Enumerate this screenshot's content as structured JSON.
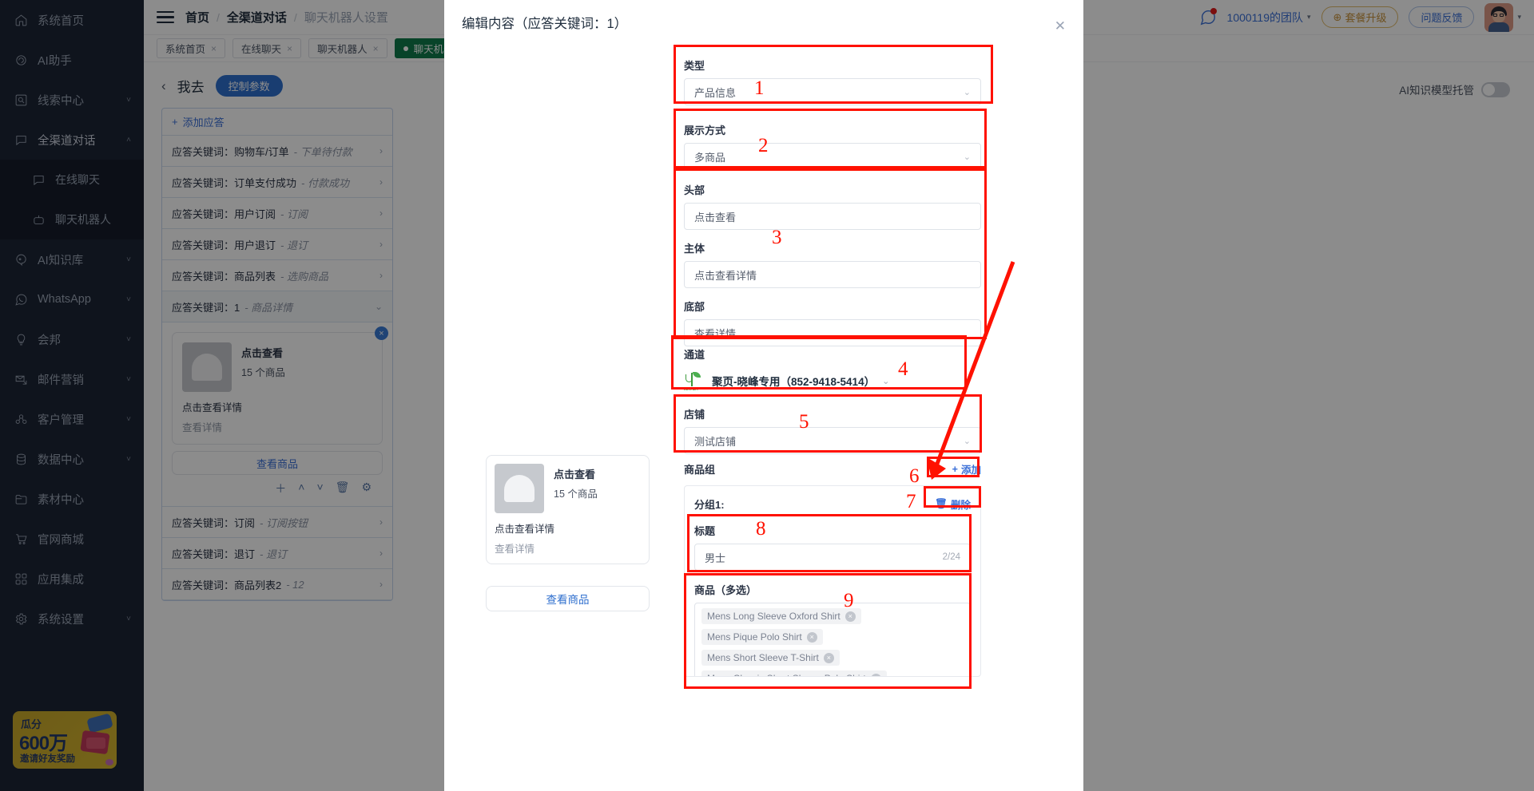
{
  "sidebar": {
    "items": [
      {
        "label": "系统首页",
        "icon": "home-icon",
        "chevron": false,
        "active": false
      },
      {
        "label": "AI助手",
        "icon": "ai-assistant-icon",
        "chevron": false,
        "active": false
      },
      {
        "label": "线索中心",
        "icon": "lead-center-icon",
        "chevron": true,
        "active": false
      },
      {
        "label": "全渠道对话",
        "icon": "omnichannel-icon",
        "chevron": true,
        "active": true,
        "expanded": true
      },
      {
        "label": "AI知识库",
        "icon": "knowledge-base-icon",
        "chevron": true,
        "active": false
      },
      {
        "label": "WhatsApp",
        "icon": "whatsapp-icon",
        "chevron": true,
        "active": false
      },
      {
        "label": "会邦",
        "icon": "huibang-icon",
        "chevron": true,
        "active": false
      },
      {
        "label": "邮件营销",
        "icon": "email-marketing-icon",
        "chevron": true,
        "active": false
      },
      {
        "label": "客户管理",
        "icon": "customer-management-icon",
        "chevron": true,
        "active": false
      },
      {
        "label": "数据中心",
        "icon": "data-center-icon",
        "chevron": true,
        "active": false
      },
      {
        "label": "素材中心",
        "icon": "material-center-icon",
        "chevron": false,
        "active": false
      },
      {
        "label": "官网商城",
        "icon": "shop-icon",
        "chevron": false,
        "active": false
      },
      {
        "label": "应用集成",
        "icon": "app-integration-icon",
        "chevron": false,
        "active": false
      },
      {
        "label": "系统设置",
        "icon": "settings-icon",
        "chevron": true,
        "active": false
      }
    ],
    "sub_items": [
      {
        "label": "在线聊天",
        "icon": "live-chat-icon"
      },
      {
        "label": "聊天机器人",
        "icon": "chatbot-icon"
      }
    ],
    "promo": {
      "line1": "瓜分",
      "line2": "600万",
      "line3": "邀请好友奖励"
    }
  },
  "topbar": {
    "breadcrumb": [
      "首页",
      "全渠道对话",
      "聊天机器人设置"
    ],
    "separator": "/",
    "team": "1000119的团队",
    "upgrade": "套餐升级",
    "feedback": "问题反馈"
  },
  "tabs": [
    {
      "label": "系统首页",
      "active": false
    },
    {
      "label": "在线聊天",
      "active": false
    },
    {
      "label": "聊天机器人",
      "active": false
    },
    {
      "label": "聊天机器人",
      "active": true
    }
  ],
  "panel": {
    "title": "我去",
    "control_button": "控制参数",
    "ai_toggle_label": "AI知识模型托管",
    "add_reply": "添加应答",
    "rows": [
      {
        "prefix": "应答关键词：",
        "keyword": "购物车/订单",
        "sub": "- 下单待付款",
        "expanded": false
      },
      {
        "prefix": "应答关键词：",
        "keyword": "订单支付成功",
        "sub": "- 付款成功",
        "expanded": false
      },
      {
        "prefix": "应答关键词：",
        "keyword": "用户订阅",
        "sub": "- 订阅",
        "expanded": false
      },
      {
        "prefix": "应答关键词：",
        "keyword": "用户退订",
        "sub": "- 退订",
        "expanded": false
      },
      {
        "prefix": "应答关键词：",
        "keyword": "商品列表",
        "sub": "- 选购商品",
        "expanded": false
      },
      {
        "prefix": "应答关键词：",
        "keyword": "1",
        "sub": "- 商品详情",
        "expanded": true
      }
    ],
    "rows_after": [
      {
        "prefix": "应答关键词：",
        "keyword": "订阅",
        "sub": "- 订阅按钮"
      },
      {
        "prefix": "应答关键词：",
        "keyword": "退订",
        "sub": "- 退订"
      },
      {
        "prefix": "应答关键词：",
        "keyword": "商品列表2",
        "sub": "- 12"
      }
    ],
    "card": {
      "header": "点击查看",
      "count": "15 个商品",
      "body": "点击查看详情",
      "footer": "查看详情",
      "button": "查看商品"
    }
  },
  "modal": {
    "title": "编辑内容（应答关键词：1）",
    "preview": {
      "header": "点击查看",
      "count": "15 个商品",
      "body": "点击查看详情",
      "footer": "查看详情",
      "button": "查看商品"
    },
    "fields": {
      "type_label": "类型",
      "type_value": "产品信息",
      "display_label": "展示方式",
      "display_value": "多商品",
      "head_label": "头部",
      "head_value": "点击查看",
      "main_label": "主体",
      "main_value": "点击查看详情",
      "bottom_label": "底部",
      "bottom_value": "查看详情",
      "channel_label": "通道",
      "channel_value": "聚页-晓峰专用（852-9418-5414）",
      "store_label": "店铺",
      "store_value": "测试店铺",
      "group_label": "商品组",
      "add_button": "添加",
      "group_name": "分组1:",
      "delete_button": "删除",
      "title_label": "标题",
      "title_value": "男士",
      "title_counter": "2/24",
      "products_label": "商品（多选）",
      "products": [
        "Mens Long Sleeve Oxford Shirt",
        "Mens Pique Polo Shirt",
        "Mens Short Sleeve T-Shirt",
        "Mens Classic Short Sleeve Polo Shirt"
      ]
    },
    "markers": [
      "1",
      "2",
      "3",
      "4",
      "5",
      "6",
      "7",
      "8",
      "9"
    ]
  },
  "colors": {
    "accent": "#3a6fd8",
    "annotation": "#ff1100",
    "sidebar_bg": "#1d2535",
    "active_tab": "#0f7a4b"
  }
}
